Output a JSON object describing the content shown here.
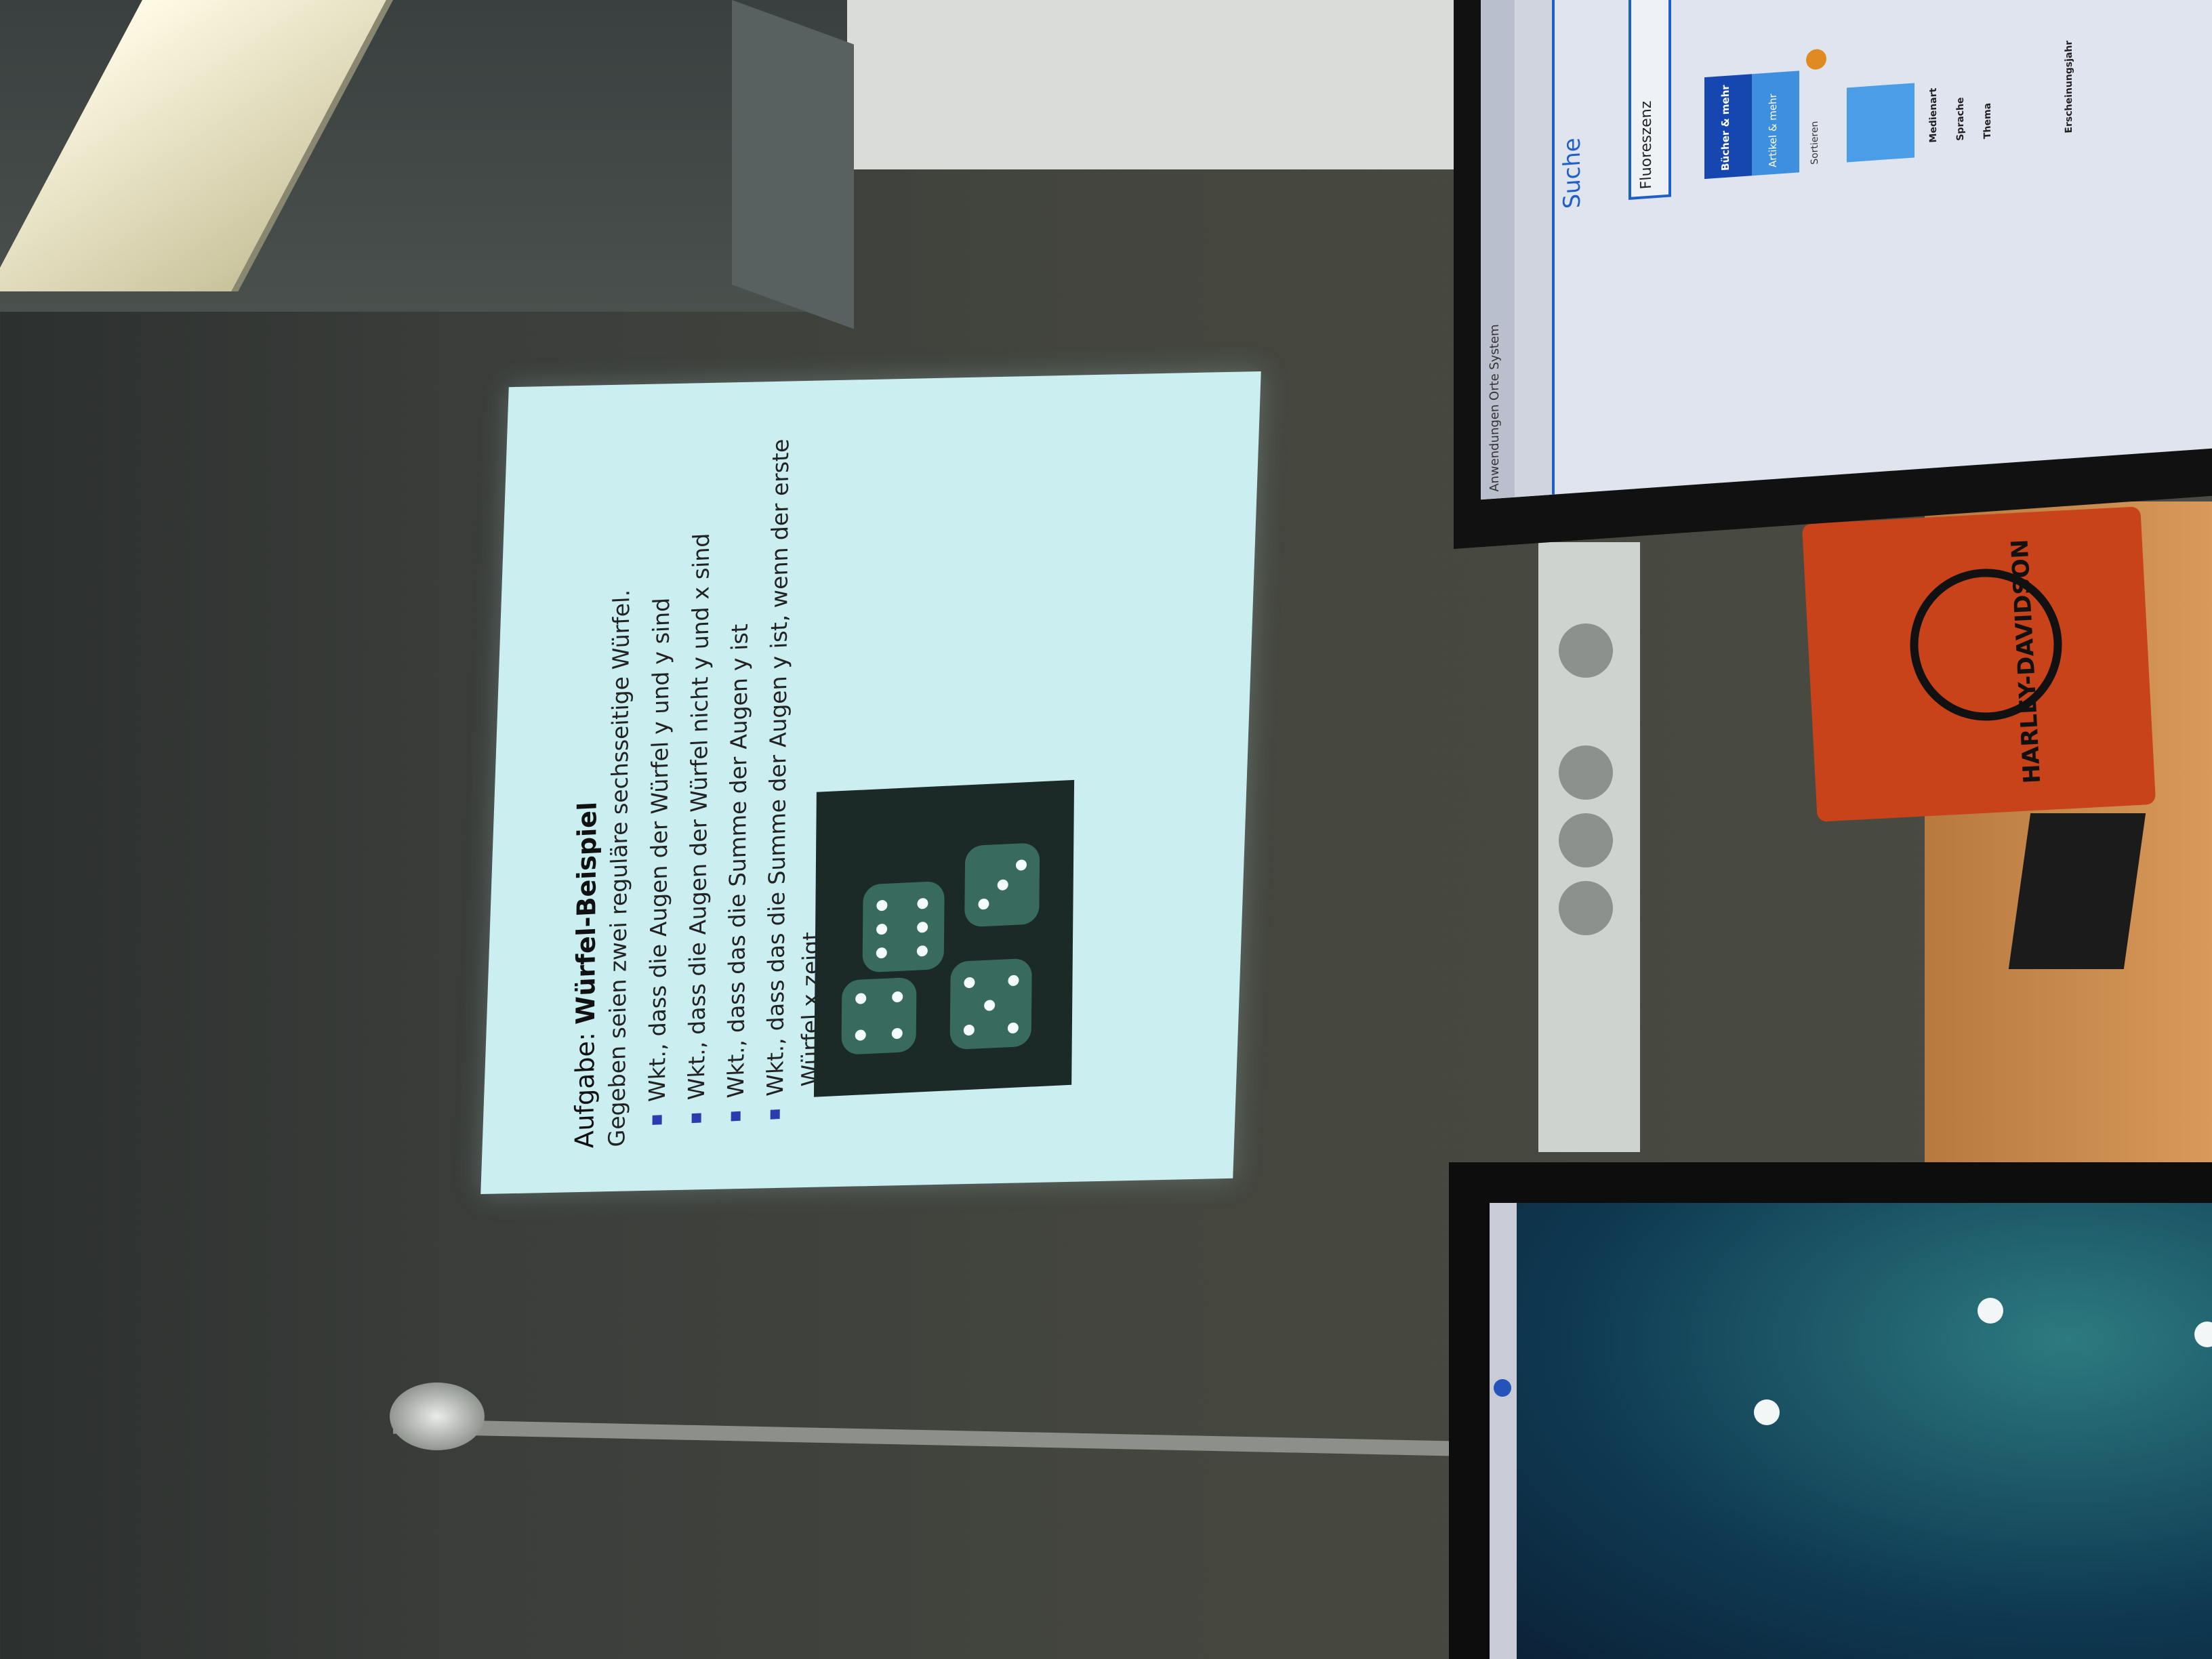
{
  "slide": {
    "title_prefix": "Aufgabe:",
    "title_main": "Würfel-Beispiel",
    "intro": "Gegeben seien zwei reguläre sechsseitige Würfel.",
    "bullets": [
      {
        "text": "Wkt., dass die Augen der Würfel y und y sind"
      },
      {
        "text": "Wkt., dass die Augen der Würfel nicht y und x sind"
      },
      {
        "text": "Wkt., dass das die Summe der Augen y ist"
      },
      {
        "text": "Wkt., dass das die Summe der Augen y ist, wenn der erste",
        "continuation": "Würfel x zeigt"
      }
    ],
    "bullet_color": "#2a3cb0",
    "background_color": "#cbeef0"
  },
  "monitor_top": {
    "menu": "Anwendungen Orte System",
    "logo": "Suche",
    "search_value": "Fluoreszenz",
    "tabs": [
      "Bücher & mehr",
      "Artikel & mehr"
    ],
    "sort_label": "Sortieren",
    "facets": [
      "Medienart",
      "Sprache",
      "Thema",
      "Erscheinungsjahr"
    ],
    "accent_color": "#1f5fc8"
  },
  "laptop": {
    "sticker": "HARLEY-DAVIDSON"
  }
}
